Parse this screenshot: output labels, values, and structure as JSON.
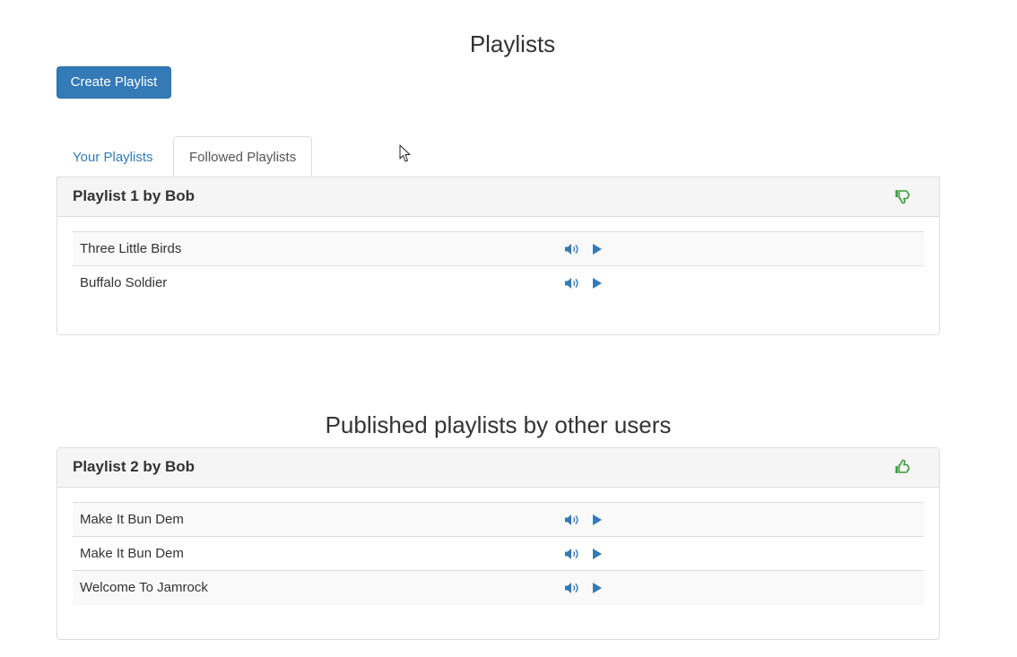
{
  "page": {
    "title": "Playlists",
    "create_button": "Create Playlist"
  },
  "tabs": [
    {
      "label": "Your Playlists",
      "active": false
    },
    {
      "label": "Followed Playlists",
      "active": true
    }
  ],
  "followed_playlist": {
    "title": "Playlist 1 by Bob",
    "action_icon": "thumbs-down-icon",
    "songs": [
      {
        "name": "Three Little Birds"
      },
      {
        "name": "Buffalo Soldier"
      }
    ]
  },
  "published_section": {
    "title": "Published playlists by other users"
  },
  "published_playlist": {
    "title": "Playlist 2 by Bob",
    "action_icon": "thumbs-up-icon",
    "songs": [
      {
        "name": "Make It Bun Dem"
      },
      {
        "name": "Make It Bun Dem"
      },
      {
        "name": "Welcome To Jamrock"
      }
    ]
  },
  "colors": {
    "primary": "#337ab7",
    "icon_green": "#3c9a3c",
    "border": "#dddddd",
    "heading_bg": "#f5f5f5"
  }
}
